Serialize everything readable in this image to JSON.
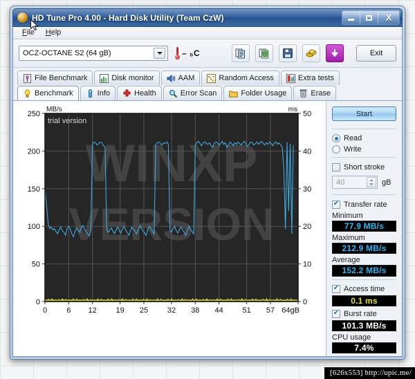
{
  "window": {
    "title": "HD Tune Pro 4.00 - Hard Disk Utility (Team CzW)",
    "minimize_label": "Minimize",
    "maximize_label": "Maximize",
    "close_label": "X"
  },
  "menu": {
    "items": [
      {
        "label": "File",
        "accel": "F"
      },
      {
        "label": "Help",
        "accel": "H"
      }
    ]
  },
  "toolbar": {
    "drive": "OCZ-OCTANE S2 (64 gB)",
    "temperature": "– ₅C",
    "buttons": [
      {
        "name": "copy-icon",
        "label": "Copy"
      },
      {
        "name": "copy-image-icon",
        "label": "Copy as image"
      },
      {
        "name": "save-icon",
        "label": "Save"
      },
      {
        "name": "coins-icon",
        "label": "Buy"
      },
      {
        "name": "download-icon",
        "label": "Download"
      }
    ],
    "exit_label": "Exit"
  },
  "tabs": {
    "row1": [
      {
        "label": "File Benchmark",
        "icon": "file-benchmark-icon",
        "active": false
      },
      {
        "label": "Disk monitor",
        "icon": "disk-monitor-icon",
        "active": false
      },
      {
        "label": "AAM",
        "icon": "aam-icon",
        "active": false
      },
      {
        "label": "Random Access",
        "icon": "random-access-icon",
        "active": false
      },
      {
        "label": "Extra tests",
        "icon": "extra-tests-icon",
        "active": false
      }
    ],
    "row2": [
      {
        "label": "Benchmark",
        "icon": "benchmark-icon",
        "active": true
      },
      {
        "label": "Info",
        "icon": "info-icon",
        "active": false
      },
      {
        "label": "Health",
        "icon": "health-icon",
        "active": false
      },
      {
        "label": "Error Scan",
        "icon": "error-scan-icon",
        "active": false
      },
      {
        "label": "Folder Usage",
        "icon": "folder-usage-icon",
        "active": false
      },
      {
        "label": "Erase",
        "icon": "erase-icon",
        "active": false
      }
    ]
  },
  "panel": {
    "start_label": "Start",
    "read_label": "Read",
    "write_label": "Write",
    "read_selected": true,
    "short_stroke_label": "Short stroke",
    "short_stroke_checked": false,
    "short_stroke_value": "40",
    "short_stroke_unit": "gB",
    "transfer_rate_label": "Transfer rate",
    "transfer_rate_checked": true,
    "minimum_label": "Minimum",
    "minimum_value": "77.9 MB/s",
    "maximum_label": "Maximum",
    "maximum_value": "212.9 MB/s",
    "average_label": "Average",
    "average_value": "152.2 MB/s",
    "access_time_label": "Access time",
    "access_time_checked": true,
    "access_time_value": "0.1 ms",
    "burst_rate_label": "Burst rate",
    "burst_rate_checked": true,
    "burst_rate_value": "101.3 MB/s",
    "cpu_usage_label": "CPU usage",
    "cpu_usage_value": "7.4%"
  },
  "overlay": {
    "trial_text": "trial version",
    "watermark_text": "[626x553] http://upic.me/",
    "background_watermark": "WINXP VERSION"
  },
  "chart_data": {
    "type": "line",
    "title": "",
    "xlabel": "",
    "ylabel": "MB/s",
    "y2label": "ms",
    "xlim": [
      0,
      64
    ],
    "ylim": [
      0,
      250
    ],
    "y2lim": [
      0,
      50
    ],
    "grid": true,
    "xticks": [
      0,
      6,
      12,
      19,
      25,
      32,
      38,
      44,
      51,
      57,
      64
    ],
    "xticklabels": [
      "0",
      "6",
      "12",
      "19",
      "25",
      "32",
      "38",
      "44",
      "51",
      "57",
      "64gB"
    ],
    "yticks": [
      0,
      50,
      100,
      150,
      200,
      250
    ],
    "yticklabels": [
      "0",
      "50",
      "100",
      "150",
      "200",
      "250"
    ],
    "y2ticks": [
      0,
      10,
      20,
      30,
      40,
      50
    ],
    "y2ticklabels": [
      "0",
      "10",
      "20",
      "30",
      "40",
      "50"
    ],
    "series": [
      {
        "name": "Transfer rate",
        "axis": "left",
        "color": "#3fa9dd",
        "units": "MB/s",
        "x": [
          0.0,
          0.4,
          0.8,
          1.2,
          1.6,
          2.0,
          2.4,
          2.8,
          3.2,
          3.6,
          4.0,
          4.4,
          4.8,
          5.2,
          5.6,
          6.0,
          6.4,
          6.8,
          7.2,
          7.6,
          8.0,
          8.4,
          8.8,
          9.2,
          9.6,
          10.0,
          10.4,
          10.8,
          11.2,
          11.6,
          12.0,
          12.4,
          12.8,
          13.2,
          13.6,
          14.0,
          14.4,
          14.8,
          15.2,
          15.6,
          16.0,
          16.4,
          16.8,
          17.2,
          17.6,
          18.0,
          18.4,
          18.8,
          19.2,
          19.6,
          20.0,
          20.4,
          20.8,
          21.2,
          21.6,
          22.0,
          22.4,
          22.8,
          23.2,
          23.6,
          24.0,
          24.4,
          24.8,
          25.2,
          25.6,
          26.0,
          26.4,
          26.8,
          27.2,
          27.6,
          28.0,
          28.4,
          28.8,
          29.2,
          29.6,
          30.0,
          30.4,
          30.8,
          31.2,
          31.6,
          32.0,
          32.4,
          32.8,
          33.2,
          33.6,
          34.0,
          34.4,
          34.8,
          35.2,
          35.6,
          36.0,
          36.4,
          36.8,
          37.2,
          37.6,
          38.0,
          38.4,
          38.8,
          39.2,
          39.6,
          40.0,
          40.4,
          40.8,
          41.2,
          41.6,
          42.0,
          42.4,
          42.8,
          43.2,
          43.6,
          44.0,
          44.4,
          44.8,
          45.2,
          45.6,
          46.0,
          46.4,
          46.8,
          47.2,
          47.6,
          48.0,
          48.4,
          48.8,
          49.2,
          49.6,
          50.0,
          50.4,
          50.8,
          51.2,
          51.6,
          52.0,
          52.4,
          52.8,
          53.2,
          53.6,
          54.0,
          54.4,
          54.8,
          55.2,
          55.6,
          56.0,
          56.4,
          56.8,
          57.2,
          57.6,
          58.0,
          58.4,
          58.8,
          59.2,
          59.6,
          60.0,
          60.4,
          60.8,
          61.2,
          61.6,
          62.0,
          62.4,
          62.8,
          63.2,
          63.6,
          64.0
        ],
        "y": [
          150,
          128,
          104,
          97,
          99,
          95,
          97,
          93,
          90,
          96,
          99,
          94,
          92,
          88,
          97,
          100,
          96,
          90,
          86,
          93,
          98,
          95,
          92,
          99,
          101,
          96,
          93,
          90,
          87,
          95,
          209,
          212,
          211,
          208,
          210,
          212,
          211,
          207,
          205,
          96,
          92,
          95,
          98,
          93,
          90,
          96,
          99,
          94,
          91,
          97,
          100,
          95,
          92,
          88,
          94,
          99,
          96,
          93,
          90,
          95,
          101,
          97,
          94,
          91,
          88,
          96,
          100,
          97,
          93,
          90,
          209,
          211,
          212,
          210,
          208,
          211,
          210,
          212,
          209,
          95,
          92,
          97,
          100,
          94,
          91,
          96,
          99,
          95,
          92,
          88,
          95,
          100,
          96,
          93,
          90,
          208,
          211,
          213,
          210,
          207,
          211,
          212,
          210,
          209,
          211,
          207,
          205,
          210,
          212,
          211,
          208,
          210,
          213,
          209,
          211,
          205,
          208,
          212,
          210,
          207,
          211,
          209,
          212,
          210,
          208,
          211,
          213,
          210,
          206,
          209,
          212,
          211,
          208,
          210,
          212,
          209,
          211,
          213,
          210,
          208,
          211,
          209,
          212,
          210,
          207,
          211,
          212,
          209,
          211,
          208,
          205,
          175,
          96,
          212,
          120,
          210,
          90,
          208
        ]
      },
      {
        "name": "Access time",
        "axis": "right",
        "color": "#e8e02a",
        "units": "ms",
        "x": [
          0,
          4,
          8,
          12,
          16,
          20,
          24,
          28,
          32,
          36,
          40,
          44,
          48,
          52,
          56,
          60,
          64
        ],
        "y": [
          0.3,
          0.25,
          0.3,
          0.28,
          0.3,
          0.26,
          0.3,
          0.27,
          0.3,
          0.25,
          0.3,
          0.28,
          0.3,
          0.26,
          0.3,
          0.27,
          0.3
        ]
      }
    ]
  }
}
